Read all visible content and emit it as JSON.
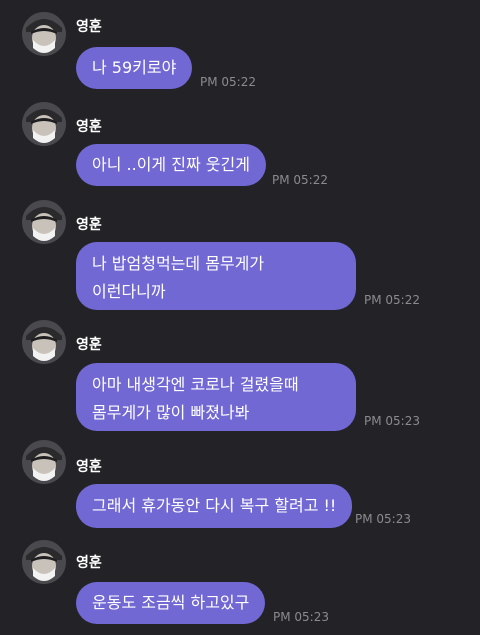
{
  "sender_name": "영훈",
  "messages": [
    {
      "text": "나 59키로야",
      "time": "PM 05:22"
    },
    {
      "text": "아니 ..이게 진짜 웃긴게",
      "time": "PM 05:22"
    },
    {
      "text": "나 밥엄청먹는데 몸무게가 이런다니까",
      "time": "PM 05:22"
    },
    {
      "text": "아마 내생각엔 코로나 걸렸을때 몸무게가 많이 빠졌나봐",
      "time": "PM 05:23"
    },
    {
      "text": "그래서 휴가동안 다시 복구 할려고 !!",
      "time": "PM 05:23"
    },
    {
      "text": "운동도 조금씩 하고있구",
      "time": "PM 05:23"
    }
  ],
  "colors": {
    "background": "#232327",
    "bubble": "#7168d4",
    "time_text": "#8a8a8f"
  },
  "icons": {
    "avatar": "profile-photo-avatar"
  }
}
